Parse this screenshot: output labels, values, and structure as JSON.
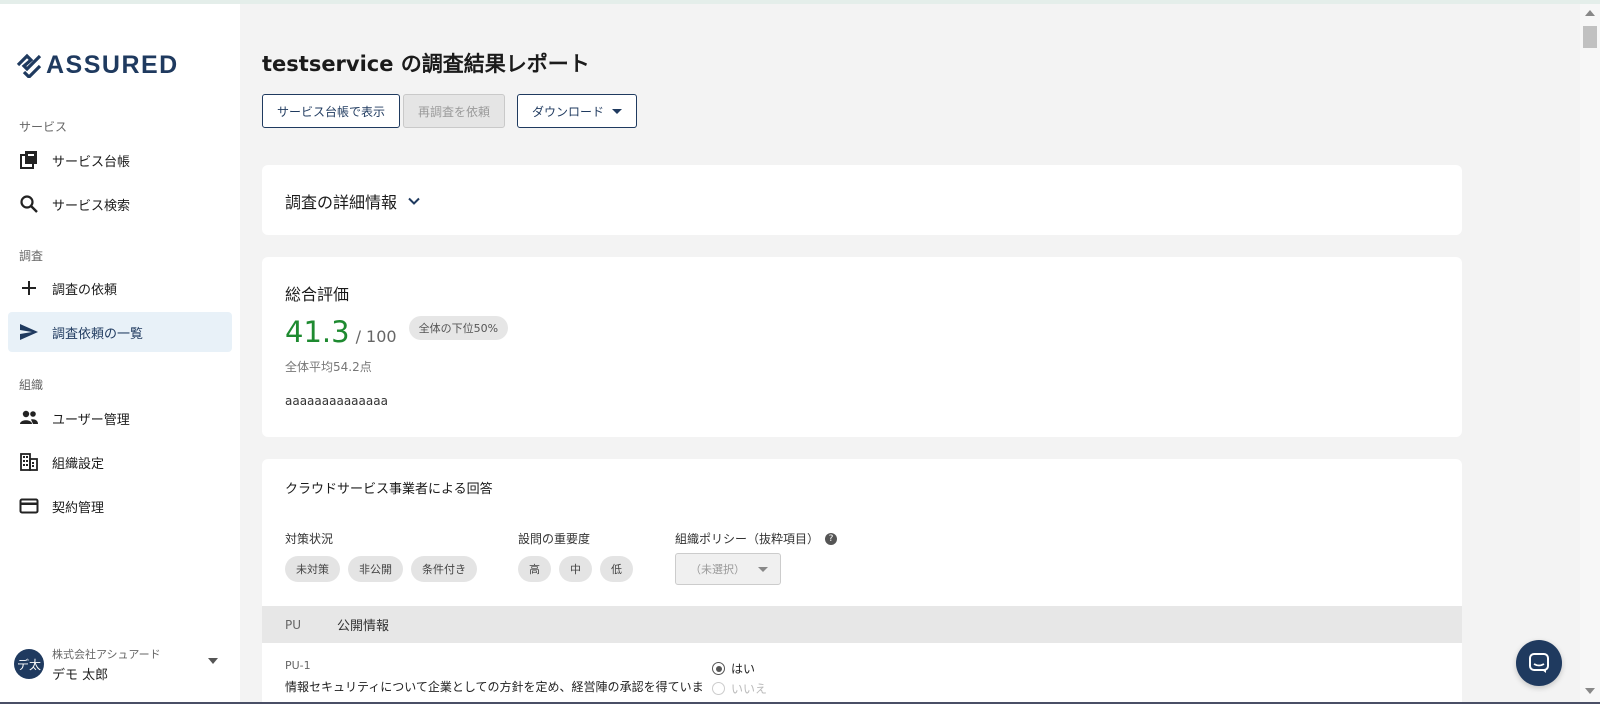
{
  "app": {
    "logo_text": "ASSURED"
  },
  "sidebar": {
    "sections": {
      "service": "サービス",
      "survey": "調査",
      "org": "組織"
    },
    "items": [
      {
        "label": "サービス台帳",
        "icon": "library-icon"
      },
      {
        "label": "サービス検索",
        "icon": "search-icon"
      },
      {
        "label": "調査の依頼",
        "icon": "plus-icon"
      },
      {
        "label": "調査依頼の一覧",
        "icon": "send-icon",
        "active": true
      },
      {
        "label": "ユーザー管理",
        "icon": "people-icon"
      },
      {
        "label": "組織設定",
        "icon": "building-icon"
      },
      {
        "label": "契約管理",
        "icon": "card-icon"
      }
    ],
    "user": {
      "avatar": "デ太",
      "org": "株式会社アシュアード",
      "name": "デモ 太郎"
    }
  },
  "main": {
    "title": "testservice の調査結果レポート",
    "buttons": {
      "show_ledger": "サービス台帳で表示",
      "request_resurvey": "再調査を依頼",
      "download": "ダウンロード"
    },
    "details_card": {
      "title": "調査の詳細情報"
    },
    "evaluation": {
      "title": "総合評価",
      "score": "41.3",
      "score_max": "/ 100",
      "rank_chip": "全体の下位50%",
      "average": "全体平均54.2点",
      "comment": "aaaaaaaaaaaaaa"
    },
    "answers": {
      "title": "クラウドサービス事業者による回答",
      "filters": {
        "status_label": "対策状況",
        "status_chips": [
          "未対策",
          "非公開",
          "条件付き"
        ],
        "importance_label": "設問の重要度",
        "importance_chips": [
          "高",
          "中",
          "低"
        ],
        "policy_label": "組織ポリシー（抜粋項目）",
        "policy_help": "?",
        "policy_select": "（未選択）"
      },
      "group": {
        "code": "PU",
        "name": "公開情報"
      },
      "question": {
        "code": "PU-1",
        "text": "情報セキュリティについて企業としての方針を定め、経営陣の承認を得ていま",
        "options": [
          {
            "label": "はい",
            "selected": true
          },
          {
            "label": "いいえ",
            "selected": false
          }
        ]
      }
    }
  },
  "colors": {
    "brand": "#1f3a5f",
    "score": "#1e8a30",
    "active_nav_bg": "#e8f1f8"
  }
}
